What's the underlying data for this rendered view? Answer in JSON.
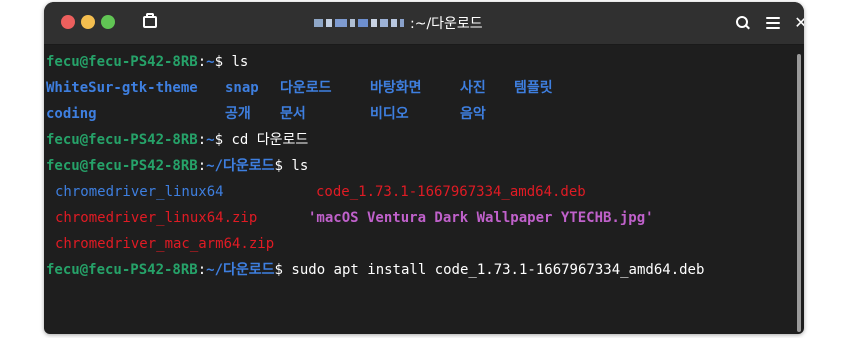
{
  "window": {
    "title": ":~/다운로드",
    "colors": {
      "background": "#1e1e1e",
      "titlebar": "#303030",
      "user_prompt": "#26a269",
      "directory": "#3e7fe0",
      "archive": "#e01b24",
      "image": "#c061cb"
    },
    "icons": [
      "close-dot",
      "minimize-dot",
      "maximize-dot",
      "new-tab-icon",
      "search-icon",
      "menu-icon",
      "close-icon"
    ]
  },
  "terminal": {
    "prompt_user": "fecu@fecu-PS42-8RB",
    "prompt_sep": ":",
    "home_path": "~",
    "dl_path": "~/다운로드",
    "prompt_end": "$ ",
    "cmd1": "ls",
    "ls1": {
      "row1": [
        "WhiteSur-gtk-theme",
        "snap",
        "다운로드",
        "바탕화면",
        "사진",
        "템플릿"
      ],
      "row2": [
        "coding",
        "공개",
        "문서",
        "비디오",
        "음악"
      ]
    },
    "cmd2": "cd 다운로드",
    "cmd3": "ls",
    "ls2": {
      "col1": [
        "chromedriver_linux64",
        "chromedriver_linux64.zip",
        "chromedriver_mac_arm64.zip"
      ],
      "col2": [
        "code_1.73.1-1667967334_amd64.deb",
        "'macOS Ventura Dark Wallpaper YTECHB.jpg'"
      ]
    },
    "cmd4": "sudo apt install code_1.73.1-1667967334_amd64.deb"
  }
}
